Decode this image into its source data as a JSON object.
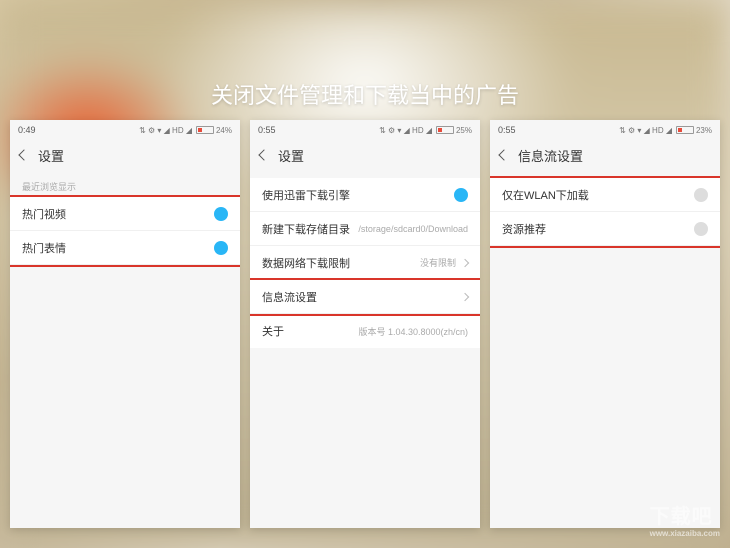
{
  "title": "关闭文件管理和下载当中的广告",
  "watermark": {
    "main": "下载吧",
    "sub": "www.xiazaiba.com"
  },
  "status": {
    "icons": "⇅ ⚙ ▾ ◢ HD ◢",
    "battery_pct": "24%",
    "battery_pct2": "25%",
    "battery_pct3": "23%"
  },
  "screens": [
    {
      "time": "0:49",
      "nav_title": "设置",
      "section": "最近浏览显示",
      "rows": [
        {
          "label": "热门视频",
          "type": "toggle_on"
        },
        {
          "label": "热门表情",
          "type": "toggle_on"
        }
      ]
    },
    {
      "time": "0:55",
      "nav_title": "设置",
      "rows": [
        {
          "label": "使用迅雷下载引擎",
          "type": "toggle_on"
        },
        {
          "label": "新建下载存储目录",
          "value": "/storage/sdcard0/Download",
          "type": "chev"
        },
        {
          "label": "数据网络下载限制",
          "value": "没有限制",
          "type": "chev"
        },
        {
          "label": "信息流设置",
          "type": "chev"
        },
        {
          "label": "关于",
          "value": "版本号 1.04.30.8000(zh/cn)",
          "type": "none"
        }
      ]
    },
    {
      "time": "0:55",
      "nav_title": "信息流设置",
      "rows": [
        {
          "label": "仅在WLAN下加载",
          "type": "toggle_off"
        },
        {
          "label": "资源推荐",
          "type": "toggle_off"
        }
      ]
    }
  ]
}
